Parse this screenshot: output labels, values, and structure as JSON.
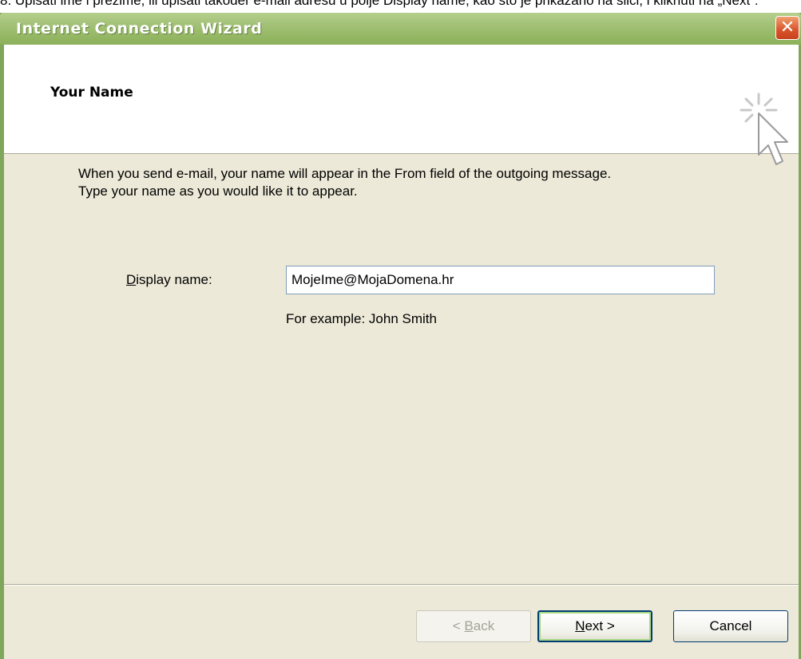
{
  "background_doc": {
    "text": "8. Upisati ime i prezime, ili upisati također e-mail adresu u polje Display name, kao što je prikazano na slici, i kliknuti na „Next“:"
  },
  "window": {
    "title": "Internet Connection Wizard",
    "close_glyph": "✕",
    "accent_color": "#8cb05c"
  },
  "header": {
    "title": "Your Name",
    "icon": "wizard-cursor-icon"
  },
  "body": {
    "description_line1": "When you send e-mail, your name will appear in the From field of the outgoing message.",
    "description_line2": "Type your name as you would like it to appear."
  },
  "form": {
    "display_name_label_mnemonic": "D",
    "display_name_label_rest": "isplay name:",
    "display_name_value": "MojeIme@MojaDomena.hr",
    "example": "For example: John Smith"
  },
  "buttons": {
    "back_prefix": "< ",
    "back_mnemonic": "B",
    "back_rest": "ack",
    "next_mnemonic": "N",
    "next_rest": "ext >",
    "cancel": "Cancel"
  }
}
